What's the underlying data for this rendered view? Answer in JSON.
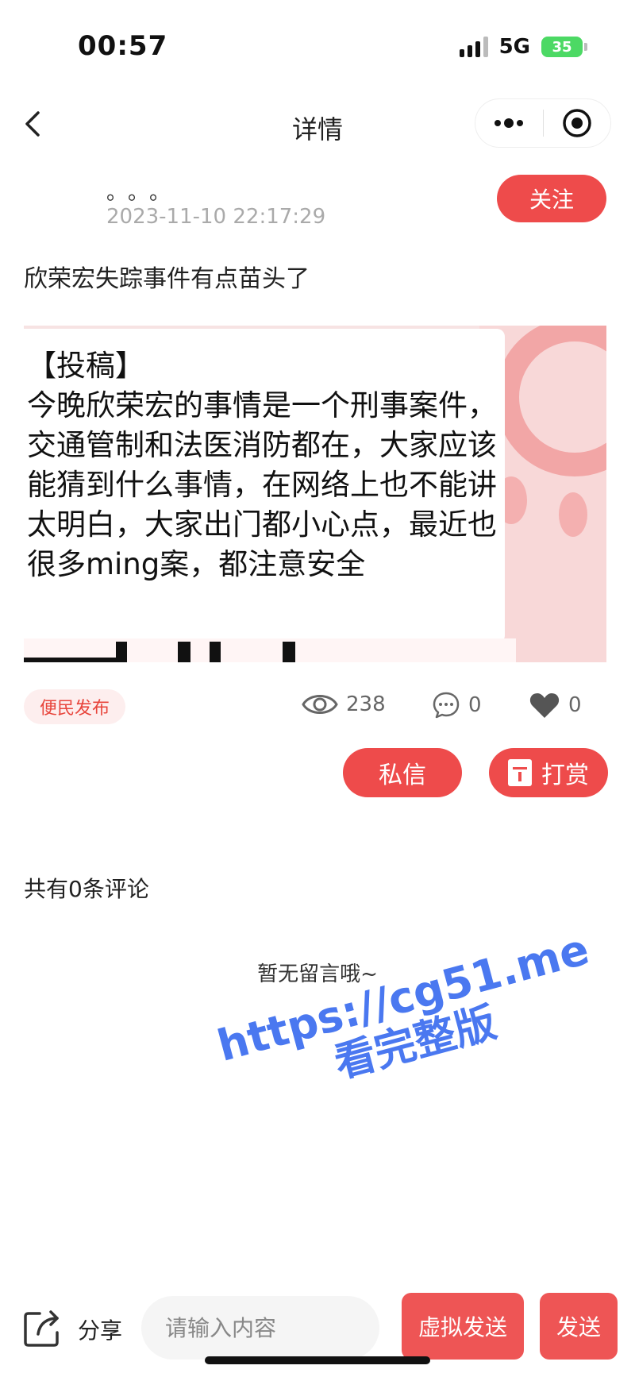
{
  "status_bar": {
    "time": "00:57",
    "network": "5G",
    "battery": "35"
  },
  "nav": {
    "title": "详情"
  },
  "author": {
    "name": "。。。",
    "post_time": "2023-11-10 22:17:29",
    "follow_label": "关注"
  },
  "post": {
    "title": "欣荣宏失踪事件有点苗头了",
    "image_text": "【投稿】\n今晚欣荣宏的事情是一个刑事案件，交通管制和法医消防都在，大家应该能猜到什么事情，在网络上也不能讲太明白，大家出门都小心点，最近也很多ming案，都注意安全",
    "tag": "便民发布",
    "views": "238",
    "comments": "0",
    "likes": "0"
  },
  "actions": {
    "message_label": "私信",
    "reward_label": "打赏"
  },
  "comments_section": {
    "count_text": "共有0条评论",
    "empty_text": "暂无留言哦~"
  },
  "watermark": {
    "url": "https://cg51.me",
    "cn": "看完整版"
  },
  "bottom_bar": {
    "share_label": "分享",
    "input_placeholder": "请输入内容",
    "virtual_send_label": "虚拟发送",
    "send_label": "发送"
  },
  "colors": {
    "accent": "#ee4b4b",
    "watermark": "#4a78f0",
    "tag_text": "#e8453c"
  }
}
